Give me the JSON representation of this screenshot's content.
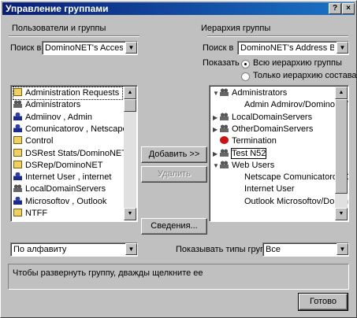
{
  "window": {
    "title": "Управление группами",
    "help_glyph": "?",
    "close_glyph": "×"
  },
  "left": {
    "group_title": "Пользователи и группы",
    "search_label": "Поиск в",
    "search_value": "DominoNET's Access B",
    "items": [
      {
        "label": "Administration Requests",
        "icon": "folder-icon"
      },
      {
        "label": "Administrators",
        "icon": "group-icon"
      },
      {
        "label": "Admiinov , Admin",
        "icon": "user-icon"
      },
      {
        "label": "Comunicatorov , Netscape",
        "icon": "user-icon"
      },
      {
        "label": "Control",
        "icon": "folder-icon"
      },
      {
        "label": "DSRest Stats/DominoNET",
        "icon": "folder-icon"
      },
      {
        "label": "DSRep/DominoNET",
        "icon": "folder-icon"
      },
      {
        "label": "Internet User , internet",
        "icon": "user-icon"
      },
      {
        "label": "LocalDomainServers",
        "icon": "group-icon"
      },
      {
        "label": "Microsoftov , Outlook",
        "icon": "user-icon"
      },
      {
        "label": "NTFF",
        "icon": "folder-icon"
      }
    ],
    "filter_value": "По алфавиту"
  },
  "right": {
    "group_title": "Иерархия группы",
    "search_label": "Поиск в",
    "search_value": "DominoNET's Address Book",
    "show_label": "Показать",
    "radio_all": "Всю иерархию группы",
    "radio_members": "Только иерархию состава",
    "tree": [
      {
        "label": "Administrators",
        "icon": "group-icon",
        "expander": "▼",
        "level": 0
      },
      {
        "label": "Admin Admirov/DominoNET",
        "icon": "",
        "expander": "",
        "level": 2
      },
      {
        "label": "LocalDomainServers",
        "icon": "group-icon",
        "expander": "▶",
        "level": 0
      },
      {
        "label": "OtherDomainServers",
        "icon": "group-icon",
        "expander": "▶",
        "level": 0
      },
      {
        "label": "Termination",
        "icon": "stop-icon",
        "expander": "",
        "level": 0
      },
      {
        "label": "Test N52",
        "icon": "group-icon",
        "expander": "▶",
        "level": 0
      },
      {
        "label": "Web Users",
        "icon": "group-icon",
        "expander": "▼",
        "level": 0
      },
      {
        "label": "Netscape Comunicatorov/Do",
        "icon": "",
        "expander": "",
        "level": 2
      },
      {
        "label": "Internet User",
        "icon": "",
        "expander": "",
        "level": 2
      },
      {
        "label": "Outlook Microsoftov/Domino",
        "icon": "",
        "expander": "",
        "level": 2
      }
    ],
    "show_types_label": "Показывать типы группы",
    "show_types_value": "Все"
  },
  "buttons": {
    "add": "Добавить >>",
    "remove": "Удалить",
    "details": "Сведения...",
    "done": "Готово"
  },
  "status_text": "Чтобы развернуть группу, дважды щелкните ее",
  "colors": {
    "title_start": "#0a1e78",
    "title_end": "#1a74c6",
    "face": "#c0c0c0"
  }
}
